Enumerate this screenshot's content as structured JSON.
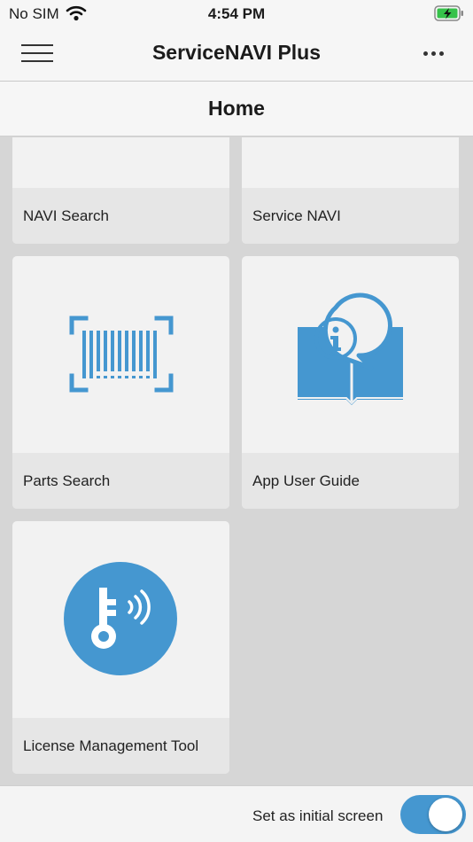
{
  "status_bar": {
    "carrier": "No SIM",
    "time": "4:54 PM",
    "icons": [
      "wifi-icon",
      "battery-charging-icon"
    ]
  },
  "nav_bar": {
    "title": "ServiceNAVI Plus",
    "menu_icon": "hamburger-icon",
    "more_icon": "more-icon"
  },
  "page": {
    "title": "Home"
  },
  "tiles": [
    {
      "label": "NAVI Search",
      "icon": "navi-search-icon"
    },
    {
      "label": "Service NAVI",
      "icon": "service-navi-icon"
    },
    {
      "label": "Parts Search",
      "icon": "barcode-scan-icon"
    },
    {
      "label": "App User Guide",
      "icon": "user-guide-book-icon"
    },
    {
      "label": "License Management Tool",
      "icon": "license-key-icon"
    }
  ],
  "footer": {
    "label": "Set as initial screen",
    "toggle_on": true
  },
  "colors": {
    "accent": "#4597d0",
    "tile_background": "#f2f2f2",
    "tile_label_background": "#e6e6e6",
    "content_background": "#d6d6d6"
  }
}
